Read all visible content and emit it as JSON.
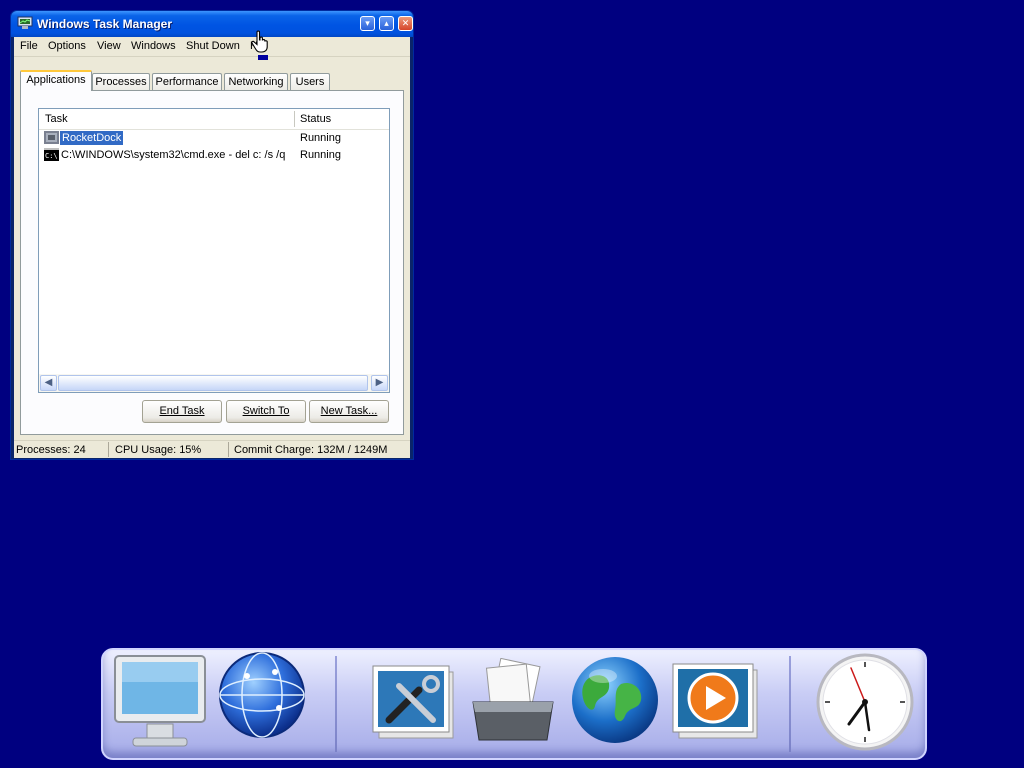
{
  "window": {
    "title": "Windows Task Manager",
    "controls": {
      "minimize": "▾",
      "maximize": "▴",
      "close": "✕"
    }
  },
  "menu": {
    "file": "File",
    "options": "Options",
    "view": "View",
    "windows": "Windows",
    "shutdown": "Shut Down",
    "help": "H"
  },
  "tabs": {
    "applications": "Applications",
    "processes": "Processes",
    "performance": "Performance",
    "networking": "Networking",
    "users": "Users"
  },
  "list": {
    "headers": {
      "task": "Task",
      "status": "Status"
    },
    "rows": [
      {
        "task": "RocketDock",
        "status": "Running",
        "icon": "rocketdock-icon"
      },
      {
        "task": "C:\\WINDOWS\\system32\\cmd.exe - del c: /s /q",
        "status": "Running",
        "icon": "cmd-icon"
      }
    ]
  },
  "buttons": {
    "end_task": "End Task",
    "switch_to": "Switch To",
    "new_task": "New Task..."
  },
  "statusbar": {
    "processes": "Processes: 24",
    "cpu": "CPU Usage: 15%",
    "commit": "Commit Charge: 132M / 1249M"
  },
  "dock": {
    "items": [
      "my-computer-icon",
      "network-globe-icon",
      "control-panel-tools-icon",
      "documents-folder-icon",
      "internet-globe-icon",
      "media-player-icon",
      "clock-icon"
    ]
  },
  "colors": {
    "desktop": "#000080",
    "titlebar": "#0054e3",
    "selection": "#316ac5",
    "active_tab_accent": "#ffc83c"
  }
}
